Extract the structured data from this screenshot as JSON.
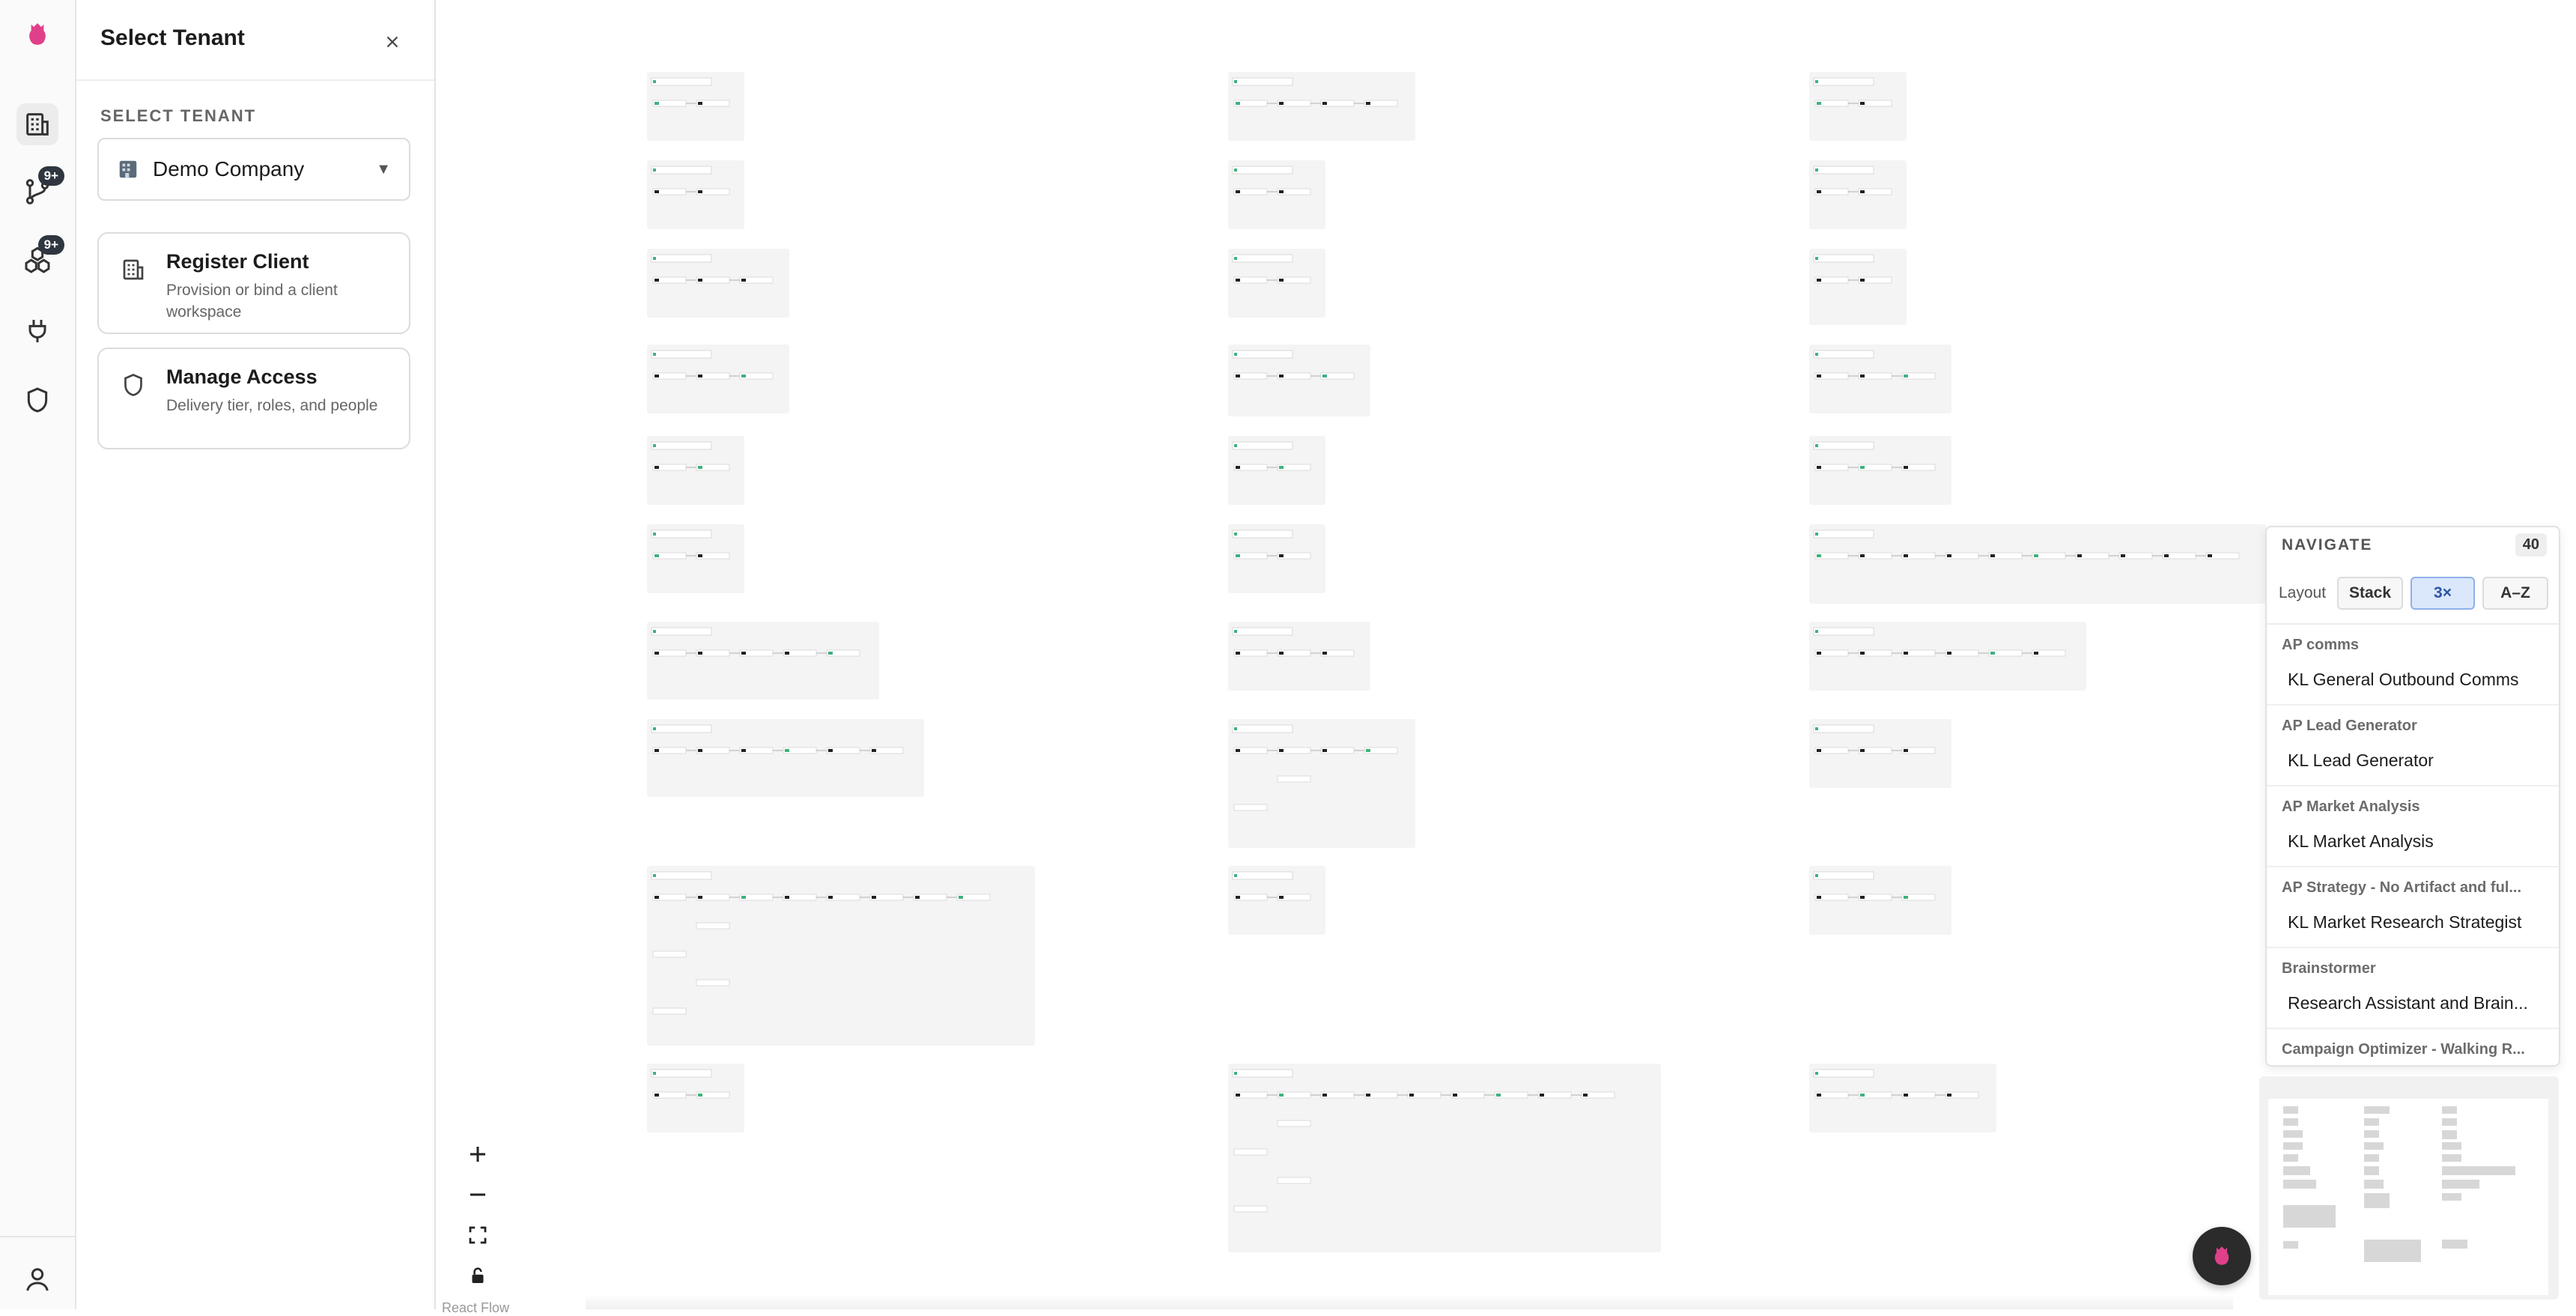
{
  "panel": {
    "title": "Select Tenant",
    "section_label": "SELECT TENANT",
    "tenant_select": {
      "value": "Demo Company"
    },
    "cards": [
      {
        "title": "Register Client",
        "description": "Provision or bind a client workspace",
        "icon": "building-icon"
      },
      {
        "title": "Manage Access",
        "description": "Delivery tier, roles, and people",
        "icon": "shield-icon"
      }
    ]
  },
  "rail": {
    "items": [
      {
        "icon": "building-icon",
        "active": true
      },
      {
        "icon": "git-branch-icon",
        "badge": "9+"
      },
      {
        "icon": "boxes-icon",
        "badge": "9+"
      },
      {
        "icon": "plug-icon"
      },
      {
        "icon": "shield-icon"
      }
    ],
    "bottom": {
      "icon": "user-icon"
    }
  },
  "canvas": {
    "attribution": "React Flow",
    "controls": [
      "zoom-in-icon",
      "zoom-out-icon",
      "fit-view-icon",
      "lock-icon"
    ]
  },
  "navigate": {
    "title": "NAVIGATE",
    "count": "40",
    "layout_label": "Layout",
    "layout_options": [
      "Stack",
      "3×",
      "A–Z"
    ],
    "active_layout": "3×",
    "groups": [
      {
        "name": "AP comms",
        "items": [
          "KL General Outbound Comms"
        ]
      },
      {
        "name": "AP Lead Generator",
        "items": [
          "KL Lead Generator"
        ]
      },
      {
        "name": "AP Market Analysis",
        "items": [
          "KL Market Analysis"
        ]
      },
      {
        "name": "AP Strategy - No Artifact and ful...",
        "items": [
          "KL Market Research Strategist"
        ]
      },
      {
        "name": "Brainstormer",
        "items": [
          "Research Assistant and Brain..."
        ]
      },
      {
        "name": "Campaign Optimizer - Walking R...",
        "items": []
      }
    ]
  },
  "colors": {
    "brand": "#e0408a",
    "active_layout": "#dbe7fb",
    "badge": "#2f3640"
  }
}
